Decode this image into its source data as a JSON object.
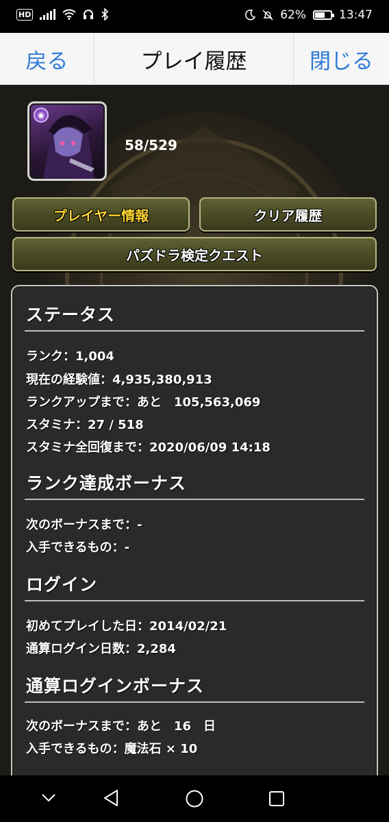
{
  "status_bar": {
    "hd": "HD",
    "battery": "62%",
    "battery_level": 0.62,
    "time": "13:47"
  },
  "header": {
    "back": "戻る",
    "title": "プレイ履歴",
    "close": "閉じる"
  },
  "player": {
    "count": "58/529",
    "avatar_attr_icon": "dark-attribute-icon"
  },
  "buttons": {
    "player_info": "プレイヤー情報",
    "clear_history": "クリア履歴",
    "quest": "パズドラ検定クエスト"
  },
  "colors": {
    "link_blue": "#2f7bd6",
    "active_yellow": "#ffd633",
    "button_olive": "#4a4c26",
    "panel_bg": "#2a2b29"
  },
  "sections": {
    "status": {
      "title": "ステータス",
      "rows": [
        "ランク：1,004",
        "現在の経験値：4,935,380,913",
        "ランクアップまで：あと　105,563,069",
        "スタミナ：27 / 518",
        "スタミナ全回復まで：2020/06/09 14:18"
      ]
    },
    "rank_bonus": {
      "title": "ランク達成ボーナス",
      "rows": [
        "次のボーナスまで：-",
        "入手できるもの：-"
      ]
    },
    "login": {
      "title": "ログイン",
      "rows": [
        "初めてプレイした日：2014/02/21",
        "通算ログイン日数：2,284"
      ]
    },
    "login_bonus": {
      "title": "通算ログインボーナス",
      "rows": [
        "次のボーナスまで：あと　16　日",
        "入手できるもの：魔法石 × 10"
      ]
    }
  },
  "navbar": [
    "chevron-down-icon",
    "back-triangle-icon",
    "home-circle-icon",
    "recents-square-icon"
  ]
}
